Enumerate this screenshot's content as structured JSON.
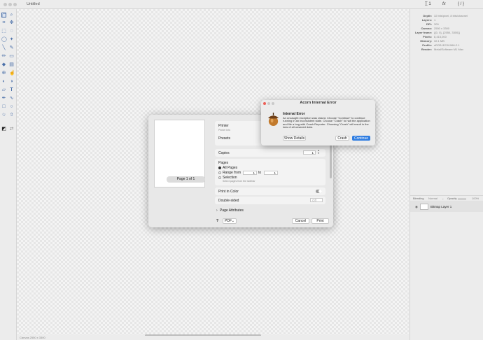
{
  "window": {
    "title": "Untitled"
  },
  "inspector_tabs": [
    "T̲ 1",
    "fx",
    "{ / }"
  ],
  "image_info": [
    {
      "label": "Depth:",
      "value": "32 bits/pixel, 8 bits/channel"
    },
    {
      "label": "Layers:",
      "value": "1"
    },
    {
      "label": "DPI:",
      "value": "300"
    },
    {
      "label": "Canvas:",
      "value": "2550 x 3300"
    },
    {
      "label": "Layer frame:",
      "value": "{{0, 0}, {2550, 3300}}"
    },
    {
      "label": "Pixels:",
      "value": "8,415,000"
    },
    {
      "label": "Memory:",
      "value": "32.1 MB"
    },
    {
      "label": "Profile:",
      "value": "sRGB IEC61966-2.1"
    },
    {
      "label": "Render:",
      "value": "Metal/Software M1 Max"
    }
  ],
  "layers_panel": {
    "blending_label": "Blending",
    "blend_mode": "Normal",
    "opacity_label": "Opacity",
    "opacity_value": "100%",
    "layer_name": "Bitmap Layer 1"
  },
  "status_bar": {
    "text": "Canvas 2550 x 3300"
  },
  "print_dialog": {
    "page_indicator": "Page 1 of 1",
    "printer_label": "Printer",
    "printer_sub": "Printer Info",
    "presets_label": "Presets",
    "copies_label": "Copies",
    "copies_value": "1",
    "pages_label": "Pages",
    "all_pages": "All Pages",
    "range_label": "Range from",
    "range_from": "1",
    "range_to_label": "to",
    "range_to": "1",
    "selection_label": "Selection",
    "selection_sub": "Select pages from the sidebar",
    "print_in_color": "Print in Color",
    "double_sided": "Double-sided",
    "double_sided_value": "Off",
    "page_attributes": "Page Attributes",
    "help": "?",
    "pdf_label": "PDF",
    "cancel": "Cancel",
    "print": "Print"
  },
  "alert": {
    "title": "Acorn Internal Error",
    "heading": "Internal Error",
    "message": "An uncaught exception was raised. Choose \"Continue\" to continue running in an inconsistent state. Choose \"Crash\" to halt the application and file a bug with Crash Reporter. Choosing \"Crash\" will result in the loss of all unsaved data.",
    "show_details": "Show Details",
    "crash": "Crash",
    "continue": "Continue"
  },
  "colors": {
    "accent": "#2f7de1",
    "tool_icon": "#4a6fa8"
  }
}
